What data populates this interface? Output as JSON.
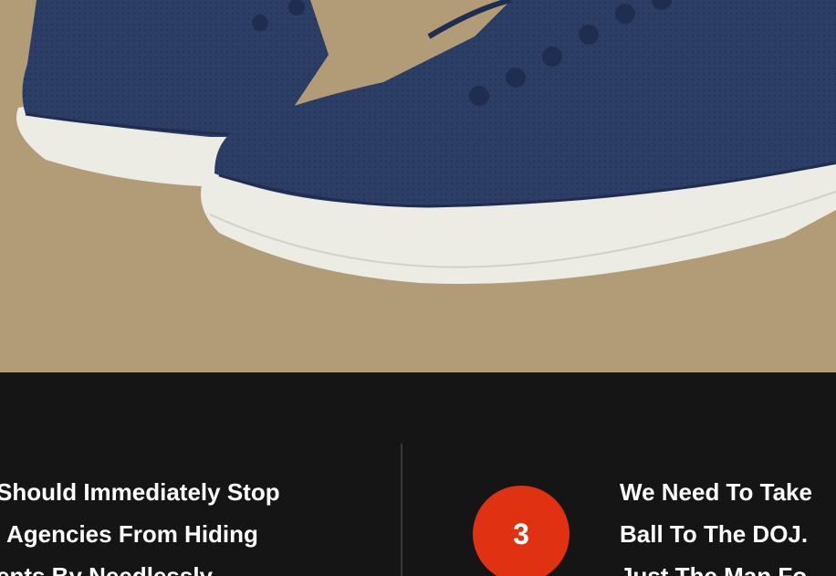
{
  "hero": {
    "image": "blue-knit-sneakers-photo",
    "background_color": "#b29c77"
  },
  "trending": {
    "items": [
      {
        "lines": [
          "Should Immediately Stop",
          "Agencies From Hiding",
          "ents By Needlessly"
        ]
      },
      {
        "rank": "3",
        "lines": [
          "We Need To Take",
          "Ball To The DOJ.",
          "Just The Man Fo"
        ]
      }
    ],
    "badge_color": "#e03212"
  }
}
